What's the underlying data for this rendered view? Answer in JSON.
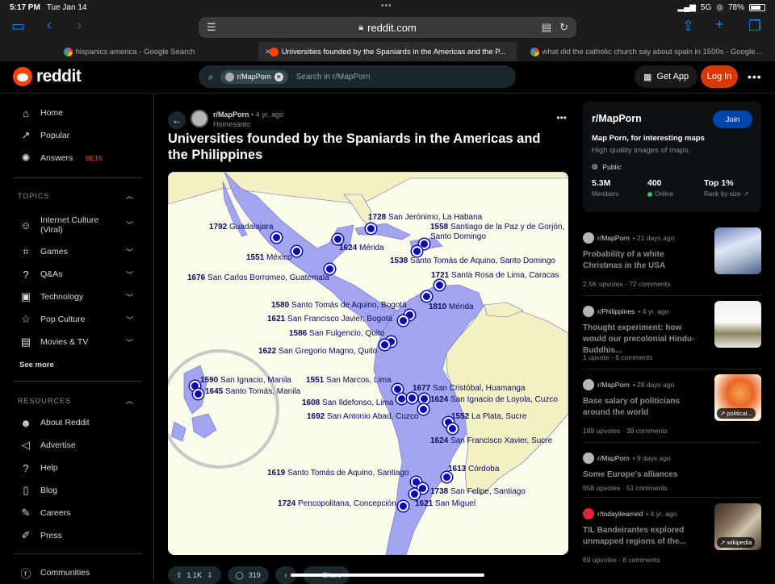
{
  "status": {
    "time": "5:17 PM",
    "date": "Tue Jan 14",
    "network": "5G",
    "battery": "78%",
    "battery_level": 0.78
  },
  "browser": {
    "url": "reddit.com",
    "tabs": [
      {
        "title": "hispanics america - Google Search",
        "active": false
      },
      {
        "title": "Universities founded by the Spaniards in the Americas and the P...",
        "active": true
      },
      {
        "title": "what did the catholic church say about spain in 1500s - Google...",
        "active": false
      }
    ]
  },
  "header": {
    "logo_text": "reddit",
    "search_chip": "r/MapPorn",
    "search_placeholder": "Search in r/MapPorn",
    "get_app": "Get App",
    "login": "Log In"
  },
  "sidebar": {
    "main": [
      {
        "label": "Home",
        "icon": "home-icon"
      },
      {
        "label": "Popular",
        "icon": "popular-icon"
      },
      {
        "label": "Answers",
        "icon": "answers-icon",
        "badge": "BETA"
      }
    ],
    "topics_label": "TOPICS",
    "topics": [
      {
        "label": "Internet Culture",
        "label2": "(Viral)",
        "icon": "smile-icon"
      },
      {
        "label": "Games",
        "icon": "gamepad-icon"
      },
      {
        "label": "Q&As",
        "icon": "question-bubble-icon"
      },
      {
        "label": "Technology",
        "icon": "chip-icon"
      },
      {
        "label": "Pop Culture",
        "icon": "star-icon"
      },
      {
        "label": "Movies & TV",
        "icon": "clapper-icon"
      }
    ],
    "see_more": "See more",
    "resources_label": "RESOURCES",
    "resources": [
      {
        "label": "About Reddit",
        "icon": "reddit-icon"
      },
      {
        "label": "Advertise",
        "icon": "megaphone-icon"
      },
      {
        "label": "Help",
        "icon": "help-icon"
      },
      {
        "label": "Blog",
        "icon": "book-icon"
      },
      {
        "label": "Careers",
        "icon": "wrench-icon"
      },
      {
        "label": "Press",
        "icon": "mic-icon"
      }
    ],
    "communities": "Communities"
  },
  "post": {
    "subreddit": "r/MapPorn",
    "age": "• 4 yr. ago",
    "author": "Homesanto",
    "title": "Universities founded by the Spaniards in the Americas and the Philippines",
    "upvotes": "1.1K",
    "comments": "319",
    "share": "Share"
  },
  "map": {
    "colors": {
      "sea": "#fbfbea",
      "land_spanish": "#a2a6f0",
      "land_other": "#f3f1c3",
      "border": "#6a6ac4",
      "pin": "#0b0bb5",
      "text": "#0b0b66"
    },
    "labels": [
      {
        "year": "1792",
        "name": "Guadalajara"
      },
      {
        "year": "1551",
        "name": "México"
      },
      {
        "year": "1676",
        "name": "San Carlos Borromeo, Guatemala"
      },
      {
        "year": "1728",
        "name": "San Jerónimo, La Habana"
      },
      {
        "year": "1624",
        "name": "Mérida"
      },
      {
        "year": "1558",
        "name": "Santiago de la Paz y de Gorjón,",
        "name2": "Santo Domingo"
      },
      {
        "year": "1538",
        "name": "Santo Tomás de Aquino, Santo Domingo"
      },
      {
        "year": "1721",
        "name": "Santa Rosa de Lima, Caracas"
      },
      {
        "year": "1810",
        "name": "Mérida"
      },
      {
        "year": "1580",
        "name": "Santo Tomás de Aquino, Bogotá"
      },
      {
        "year": "1621",
        "name": "San Francisco Javier, Bogotá"
      },
      {
        "year": "1586",
        "name": "San Fulgencio, Quito"
      },
      {
        "year": "1622",
        "name": "San Gregorio Magno, Quito"
      },
      {
        "year": "1590",
        "name": "San Ignacio, Manila"
      },
      {
        "year": "1645",
        "name": "Santo Tomás, Manila"
      },
      {
        "year": "1551",
        "name": "San Marcos, Lima"
      },
      {
        "year": "1608",
        "name": "San Ildefonso, Lima"
      },
      {
        "year": "1692",
        "name": "San Antonio Abad, Cuzco"
      },
      {
        "year": "1677",
        "name": "San Cristóbal, Huamanga"
      },
      {
        "year": "1624",
        "name": "San Ignacio de Loyola, Cuzco"
      },
      {
        "year": "1552",
        "name": "La Plata, Sucre"
      },
      {
        "year": "1624",
        "name": "San Francisco Xavier, Sucre"
      },
      {
        "year": "1613",
        "name": "Córdoba"
      },
      {
        "year": "1619",
        "name": "Santo Tomás de Aquino, Santiago"
      },
      {
        "year": "1738",
        "name": "San Felipe, Santiago"
      },
      {
        "year": "1724",
        "name": "Pencopolitana, Concepción"
      },
      {
        "year": "1621",
        "name": "San Miguel"
      }
    ]
  },
  "right": {
    "sub_name": "r/MapPorn",
    "join": "Join",
    "sub_title": "Map Porn, for interesting maps",
    "sub_desc": "High quality images of maps.",
    "public": "Public",
    "members_v": "5.3M",
    "members_l": "Members",
    "online_v": "400",
    "online_l": "Online",
    "rank_v": "Top 1%",
    "rank_l": "Rank by size",
    "feed": [
      {
        "sub": "r/MapPorn",
        "age": "• 21 days ago",
        "title": "Probability of a white Christmas in the USA",
        "upvotes": "2.5K upvotes",
        "comments": "72 comments"
      },
      {
        "sub": "r/Philippines",
        "age": "• 4 yr. ago",
        "title": "Thought experiment: how would our precolonial Hindu-Buddhis...",
        "upvotes": "1 upvote",
        "comments": "6 comments"
      },
      {
        "sub": "r/MapPorn",
        "age": "• 28 days ago",
        "title": "Base salary of politicians around the world",
        "upvotes": "189 upvotes",
        "comments": "38 comments",
        "tag": "political..."
      },
      {
        "sub": "r/MapPorn",
        "age": "• 9 days ago",
        "title": "Some Europe's alliances",
        "upvotes": "658 upvotes",
        "comments": "51 comments"
      },
      {
        "sub": "r/todayilearned",
        "age": "• 4 yr. ago",
        "title": "TIL Bandeirantes explored unmapped regions of the...",
        "upvotes": "69 upvotes",
        "comments": "8 comments",
        "tag": "wikipedia"
      }
    ]
  }
}
